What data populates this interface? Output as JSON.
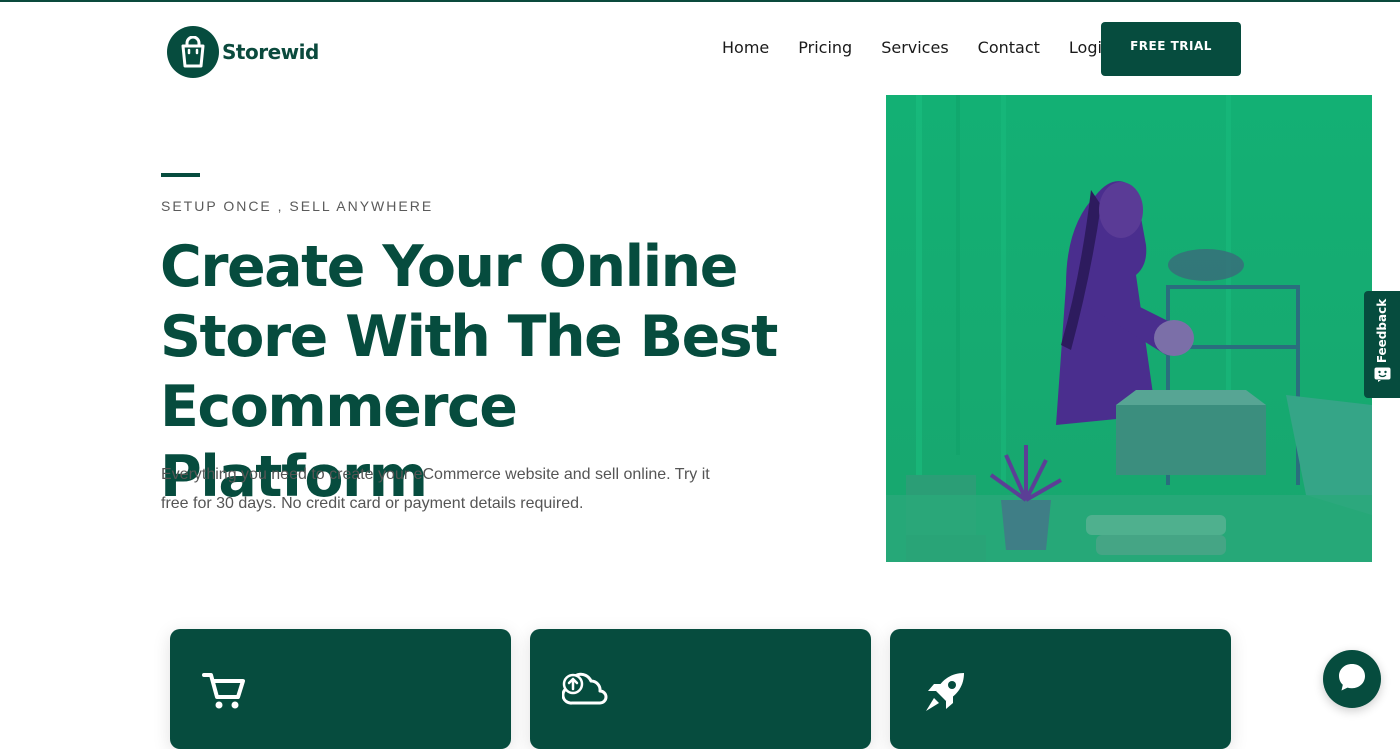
{
  "brand": {
    "name": "Storewid",
    "primary_color": "#064c3e",
    "image_tint_color": "#16ad72",
    "logo_icon": "shopping-bag-icon"
  },
  "nav": {
    "items": [
      "Home",
      "Pricing",
      "Services",
      "Contact",
      "Login"
    ],
    "cta_label": "FREE TRIAL"
  },
  "hero": {
    "eyebrow": "SETUP ONCE , SELL ANYWHERE",
    "title": "Create Your Online Store With The Best Ecommerce Platform",
    "description": "Everything you need to create your eCommerce website and sell online. Try it free for 30 days. No credit card or payment details required.",
    "image_subject": "woman-packing-box-photo"
  },
  "feedback": {
    "label": "Feedback"
  },
  "features": {
    "cards": [
      {
        "icon": "shopping-cart-icon"
      },
      {
        "icon": "cloud-upload-icon"
      },
      {
        "icon": "rocket-icon"
      }
    ]
  },
  "chat": {
    "icon": "chat-bubble-icon"
  }
}
